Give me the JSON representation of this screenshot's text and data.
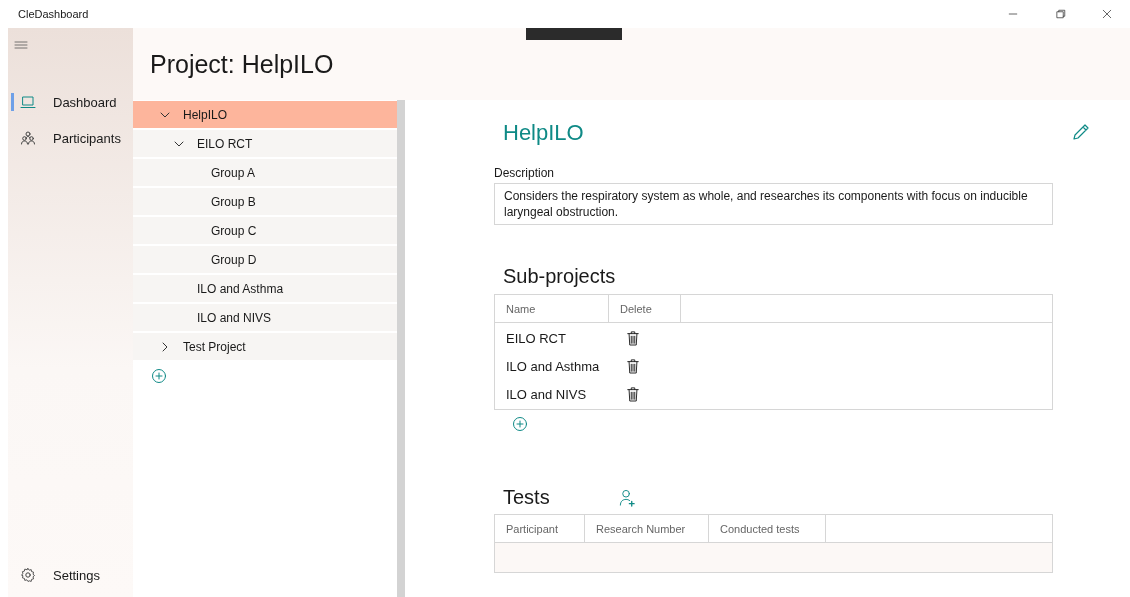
{
  "window": {
    "title": "CleDashboard"
  },
  "nav": {
    "items": [
      {
        "label": "Dashboard",
        "selected": true
      },
      {
        "label": "Participants",
        "selected": false
      }
    ],
    "footer": {
      "label": "Settings"
    }
  },
  "header": {
    "title": "Project: HelpILO"
  },
  "tree": {
    "items": [
      {
        "label": "HelpILO",
        "selected": true,
        "expanded": true,
        "children": [
          {
            "label": "EILO RCT",
            "selected": false,
            "expanded": true,
            "children": [
              {
                "label": "Group A",
                "selected": false
              },
              {
                "label": "Group B",
                "selected": false
              },
              {
                "label": "Group C",
                "selected": false
              },
              {
                "label": "Group D",
                "selected": false
              }
            ]
          },
          {
            "label": "ILO and Asthma",
            "selected": false
          },
          {
            "label": "ILO and NIVS",
            "selected": false
          }
        ]
      },
      {
        "label": "Test Project",
        "selected": false,
        "expanded": false
      }
    ]
  },
  "detail": {
    "title": "HelpILO",
    "description_label": "Description",
    "description": "Considers the respiratory system as whole, and researches its components with focus on inducible laryngeal obstruction.",
    "subprojects": {
      "heading": "Sub-projects",
      "columns": [
        "Name",
        "Delete"
      ],
      "rows": [
        {
          "name": "EILO RCT"
        },
        {
          "name": "ILO and Asthma"
        },
        {
          "name": "ILO and NIVS"
        }
      ]
    },
    "tests": {
      "heading": "Tests",
      "columns": [
        "Participant",
        "Research Number",
        "Conducted tests"
      ]
    }
  }
}
